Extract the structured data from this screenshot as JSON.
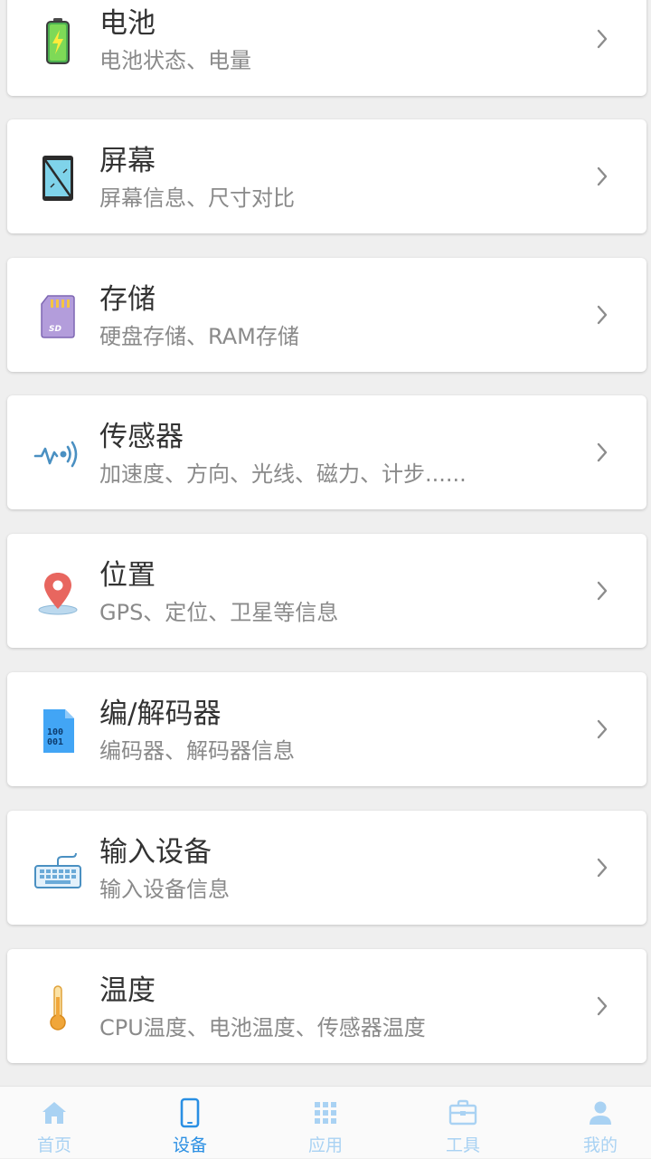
{
  "items": [
    {
      "title": "电池",
      "subtitle": "电池状态、电量",
      "icon": "battery-icon"
    },
    {
      "title": "屏幕",
      "subtitle": "屏幕信息、尺寸对比",
      "icon": "screen-icon"
    },
    {
      "title": "存储",
      "subtitle": "硬盘存储、RAM存储",
      "icon": "sd-card-icon"
    },
    {
      "title": "传感器",
      "subtitle": "加速度、方向、光线、磁力、计步......",
      "icon": "sensor-icon"
    },
    {
      "title": "位置",
      "subtitle": "GPS、定位、卫星等信息",
      "icon": "location-pin-icon"
    },
    {
      "title": "编/解码器",
      "subtitle": "编码器、解码器信息",
      "icon": "codec-file-icon"
    },
    {
      "title": "输入设备",
      "subtitle": "输入设备信息",
      "icon": "keyboard-icon"
    },
    {
      "title": "温度",
      "subtitle": "CPU温度、电池温度、传感器温度",
      "icon": "thermometer-icon"
    }
  ],
  "tabs": [
    {
      "label": "首页",
      "icon": "home-icon",
      "active": false
    },
    {
      "label": "设备",
      "icon": "phone-icon",
      "active": true
    },
    {
      "label": "应用",
      "icon": "grid-icon",
      "active": false
    },
    {
      "label": "工具",
      "icon": "toolbox-icon",
      "active": false
    },
    {
      "label": "我的",
      "icon": "person-icon",
      "active": false
    }
  ],
  "colors": {
    "accent": "#2a8fe3",
    "tab_inactive": "#a9d2f3",
    "title_text": "#333333",
    "subtitle_text": "#8a8a8a",
    "background": "#efefef"
  }
}
